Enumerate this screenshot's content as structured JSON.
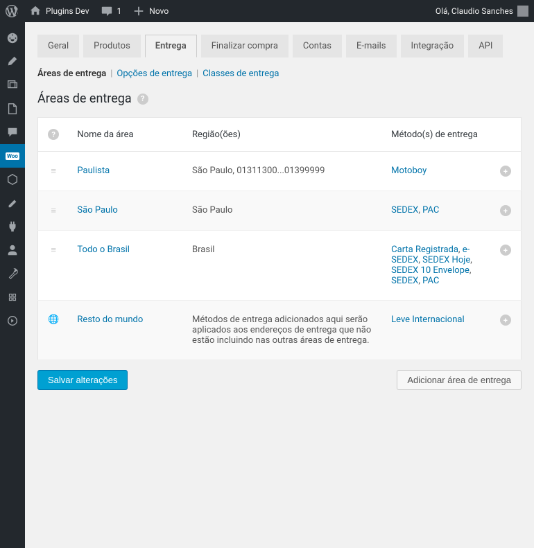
{
  "adminbar": {
    "site_name": "Plugins Dev",
    "comments_count": "1",
    "new_label": "Novo",
    "greeting": "Olá, Claudio Sanches"
  },
  "tabs": [
    {
      "label": "Geral"
    },
    {
      "label": "Produtos"
    },
    {
      "label": "Entrega",
      "active": true
    },
    {
      "label": "Finalizar compra"
    },
    {
      "label": "Contas"
    },
    {
      "label": "E-mails"
    },
    {
      "label": "Integração"
    },
    {
      "label": "API"
    }
  ],
  "subnav": [
    {
      "label": "Áreas de entrega",
      "active": true
    },
    {
      "label": "Opções de entrega"
    },
    {
      "label": "Classes de entrega"
    }
  ],
  "page": {
    "title": "Áreas de entrega"
  },
  "table": {
    "headers": {
      "name": "Nome da área",
      "region": "Região(ões)",
      "methods": "Método(s) de entrega"
    },
    "rows": [
      {
        "draggable": true,
        "name": "Paulista",
        "region": "São Paulo, 01311300...01399999",
        "methods": [
          "Motoboy"
        ]
      },
      {
        "draggable": true,
        "name": "São Paulo",
        "region": "São Paulo",
        "methods": [
          "SEDEX",
          "PAC"
        ]
      },
      {
        "draggable": true,
        "name": "Todo o Brasil",
        "region": "Brasil",
        "methods": [
          "Carta Registrada",
          "e-SEDEX",
          "SEDEX Hoje",
          "SEDEX 10 Envelope",
          "SEDEX",
          "PAC"
        ]
      },
      {
        "draggable": false,
        "name": "Resto do mundo",
        "region": "Métodos de entrega adicionados aqui serão aplicados aos endereços de entrega que não estão incluindo nas outras áreas de entrega.",
        "methods": [
          "Leve Internacional"
        ]
      }
    ]
  },
  "actions": {
    "save": "Salvar alterações",
    "add_zone": "Adicionar área de entrega"
  }
}
